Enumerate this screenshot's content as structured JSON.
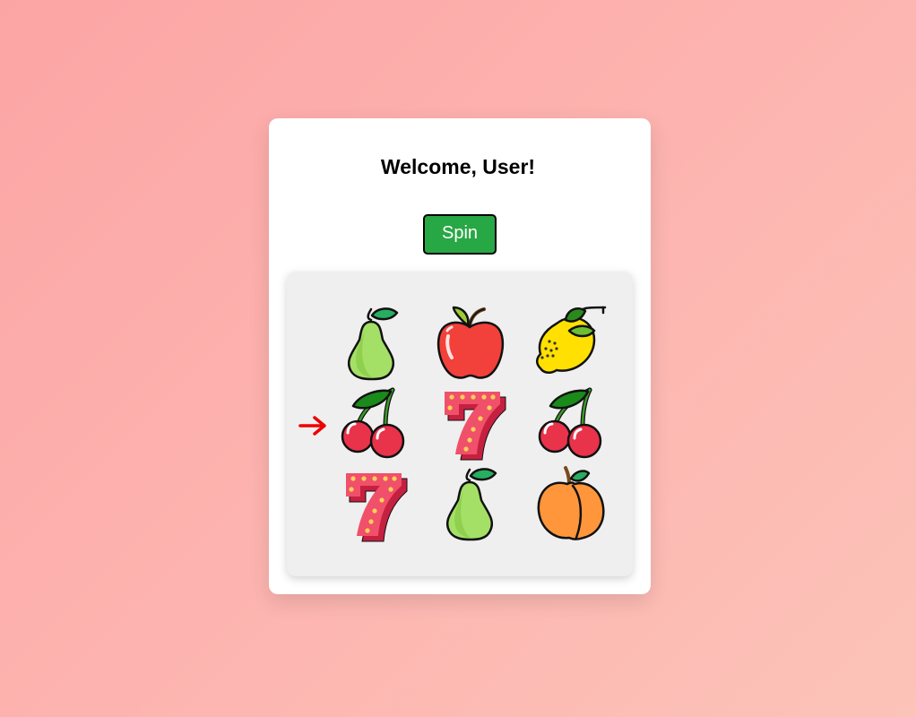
{
  "header": {
    "title": "Welcome, User!"
  },
  "controls": {
    "spin_label": "Spin"
  },
  "payline": {
    "indicator_icon": "right-arrow-icon",
    "color": "#ee0000",
    "row": 2
  },
  "reels": {
    "grid": [
      [
        "pear",
        "apple",
        "lemon"
      ],
      [
        "cherry",
        "seven",
        "cherry"
      ],
      [
        "seven",
        "pear",
        "peach"
      ]
    ]
  },
  "colors": {
    "spin_button": "#28a745",
    "background_start": "#fca5a5",
    "background_end": "#fcc3b8"
  }
}
